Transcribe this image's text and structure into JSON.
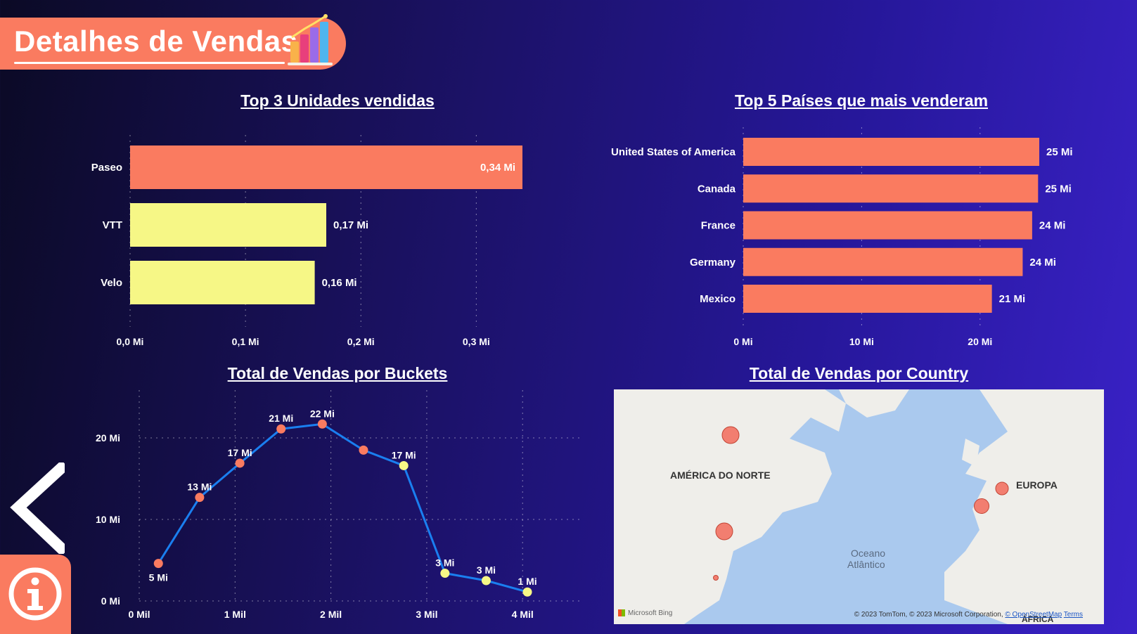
{
  "header": {
    "title": "Detalhes de Vendas"
  },
  "chart_data": [
    {
      "id": "units",
      "type": "bar",
      "orientation": "horizontal",
      "title": "Top 3 Unidades vendidas",
      "categories": [
        "Paseo",
        "VTT",
        "Velo"
      ],
      "values": [
        0.34,
        0.17,
        0.16
      ],
      "value_labels": [
        "0,34 Mi",
        "0,17 Mi",
        "0,16 Mi"
      ],
      "bar_colors": [
        "#fa7b60",
        "#f6f786",
        "#f6f786"
      ],
      "xlim": [
        0,
        0.34
      ],
      "xticks": [
        0,
        0.1,
        0.2,
        0.3
      ],
      "xtick_labels": [
        "0,0 Mi",
        "0,1 Mi",
        "0,2 Mi",
        "0,3 Mi"
      ],
      "grid": true
    },
    {
      "id": "countries",
      "type": "bar",
      "orientation": "horizontal",
      "title": "Top 5 Países que mais venderam",
      "categories": [
        "United States of America",
        "Canada",
        "France",
        "Germany",
        "Mexico"
      ],
      "values": [
        25.0,
        24.9,
        24.4,
        23.6,
        21.0
      ],
      "value_labels": [
        "25 Mi",
        "25 Mi",
        "24 Mi",
        "24 Mi",
        "21 Mi"
      ],
      "bar_colors": [
        "#fa7b60",
        "#fa7b60",
        "#fa7b60",
        "#fa7b60",
        "#fa7b60"
      ],
      "xlim": [
        0,
        25
      ],
      "xticks": [
        0,
        10,
        20
      ],
      "xtick_labels": [
        "0 Mi",
        "10 Mi",
        "20 Mi"
      ],
      "grid": true
    },
    {
      "id": "buckets",
      "type": "line",
      "title": "Total de Vendas por Buckets",
      "x": [
        0.2,
        0.63,
        1.05,
        1.48,
        1.91,
        2.34,
        2.76,
        3.19,
        3.62,
        4.05
      ],
      "y": [
        4.6,
        12.7,
        16.9,
        21.1,
        21.7,
        18.5,
        16.6,
        3.4,
        2.5,
        1.1
      ],
      "point_labels": [
        "5 Mi",
        "13 Mi",
        "17 Mi",
        "21 Mi",
        "22 Mi",
        "",
        "17 Mi",
        "3 Mi",
        "3 Mi",
        "1 Mi"
      ],
      "point_colors": [
        "#fa7b60",
        "#fa7b60",
        "#fa7b60",
        "#fa7b60",
        "#fa7b60",
        "#fa7b60",
        "#f6f786",
        "#f6f786",
        "#f6f786",
        "#f6f786"
      ],
      "line_color": "#1a7ff0",
      "xlim": [
        0,
        4.6
      ],
      "ylim": [
        0,
        25
      ],
      "xticks": [
        0,
        1,
        2,
        3,
        4
      ],
      "xtick_labels": [
        "0 Mil",
        "1 Mil",
        "2 Mil",
        "3 Mil",
        "4 Mil"
      ],
      "yticks": [
        0,
        10,
        20
      ],
      "ytick_labels": [
        "0 Mi",
        "10 Mi",
        "20 Mi"
      ],
      "grid": true
    }
  ],
  "map": {
    "title": "Total de Vendas por Country",
    "labels": {
      "north_america": "AMÉRICA DO NORTE",
      "europe": "EUROPA",
      "ocean_line1": "Oceano",
      "ocean_line2": "Atlântico",
      "africa": "ÁFRICA"
    },
    "attribution": "© 2023 TomTom, © 2023 Microsoft Corporation, ",
    "attribution_osm": "© OpenStreetMap",
    "attribution_terms": "Terms",
    "brand": "Microsoft Bing",
    "bubble_color": "#f26a5a"
  }
}
